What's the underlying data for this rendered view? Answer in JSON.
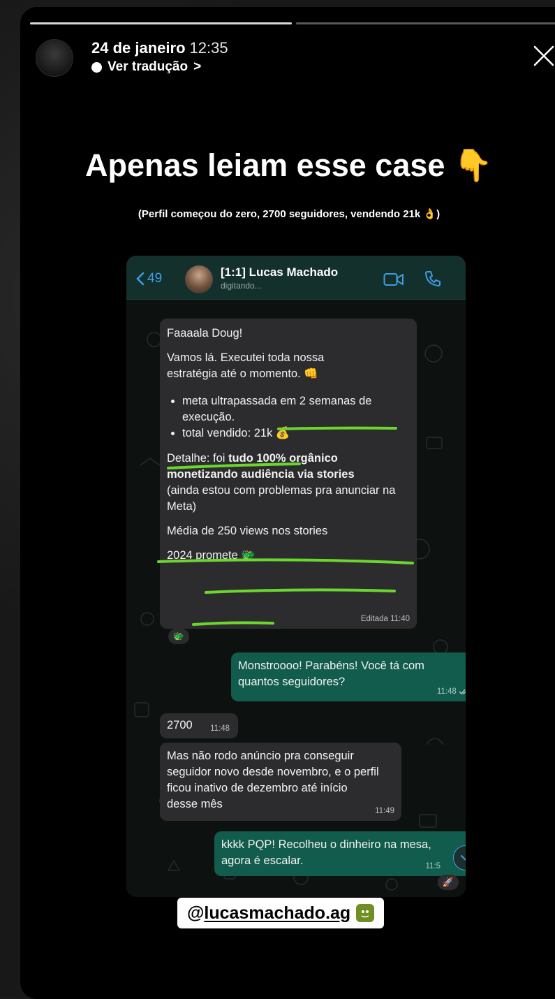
{
  "header": {
    "date": "24 de janeiro",
    "time": "12:35",
    "translate_label": "Ver tradução",
    "translate_chevron": ">",
    "close_icon": "close-icon",
    "progress_segments": 2
  },
  "title": {
    "text": "Apenas leiam esse case",
    "emoji": "👇"
  },
  "subtitle": "(Perfil começou do zero, 2700 seguidores, vendendo 21k 👌)",
  "chat": {
    "header": {
      "back_count": "49",
      "contact_name": "[1:1] Lucas Machado",
      "status": "digitando..."
    },
    "messages": {
      "m1": {
        "greeting": "Faaaala Doug!",
        "p1a": "Vamos lá. Executei toda nossa",
        "p1b": "estratégia até o momento. 👊",
        "bullet1": "meta ultrapassada em 2 semanas de execução.",
        "bullet2": "total vendido: 21k 💰",
        "detalhe_prefix": "Detalhe: foi ",
        "detalhe_bold": "tudo 100% orgânico monetizando audiência via stories",
        "detalhe_suffix": "(ainda estou com problemas pra anunciar na Meta)",
        "media": "Média de 250 views nos stories",
        "promete": "2024 promete 🐲",
        "time": "Editada 11:40",
        "reaction": "🐲"
      },
      "m2": {
        "text": "Monstroooo! Parabéns! Você tá com quantos seguidores?",
        "time": "11:48"
      },
      "m3": {
        "text": "2700",
        "time": "11:48"
      },
      "m4": {
        "text": "Mas não rodo anúncio pra conseguir seguidor novo desde novembro, e o perfil ficou inativo de dezembro até início desse mês",
        "time": "11:49"
      },
      "m5": {
        "text": "kkkk PQP! Recolheu o dinheiro na mesa, agora é escalar.",
        "time": "11:5",
        "reaction": "🚀"
      }
    }
  },
  "handle": {
    "at": "@",
    "name": "lucasmachado.ag"
  },
  "colors": {
    "highlight": "#6bd62e",
    "incoming_bubble": "#2c2c2e",
    "outgoing_bubble": "#125c4d",
    "ios_blue": "#3f9de0"
  }
}
